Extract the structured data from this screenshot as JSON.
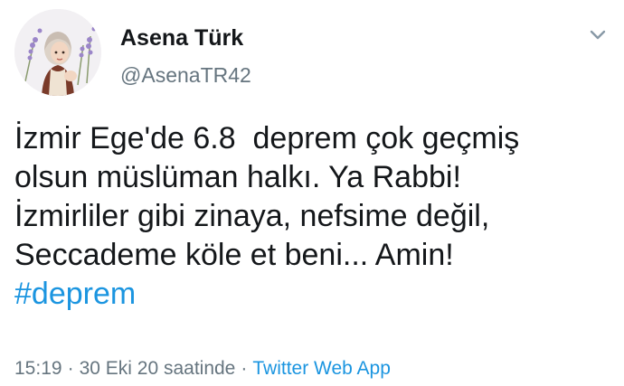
{
  "author": {
    "display_name": "Asena Türk",
    "handle": "@AsenaTR42",
    "avatar_icon": "profile-avatar"
  },
  "menu_icon": "chevron-down-icon",
  "tweet": {
    "lines": [
      "İzmir Ege'de 6.8  deprem çok geçmiş",
      "olsun müslüman halkı. Ya Rabbi!",
      "İzmirliler gibi zinaya, nefsime değil,",
      "Seccademe köle et beni... Amin!"
    ],
    "hashtag": "#deprem"
  },
  "meta": {
    "timestamp": "15:19",
    "separator": "·",
    "date": "30 Eki 20 saatinde",
    "source": "Twitter Web App"
  },
  "colors": {
    "text": "#14171a",
    "secondary": "#66757f",
    "link": "#1b95e0"
  }
}
